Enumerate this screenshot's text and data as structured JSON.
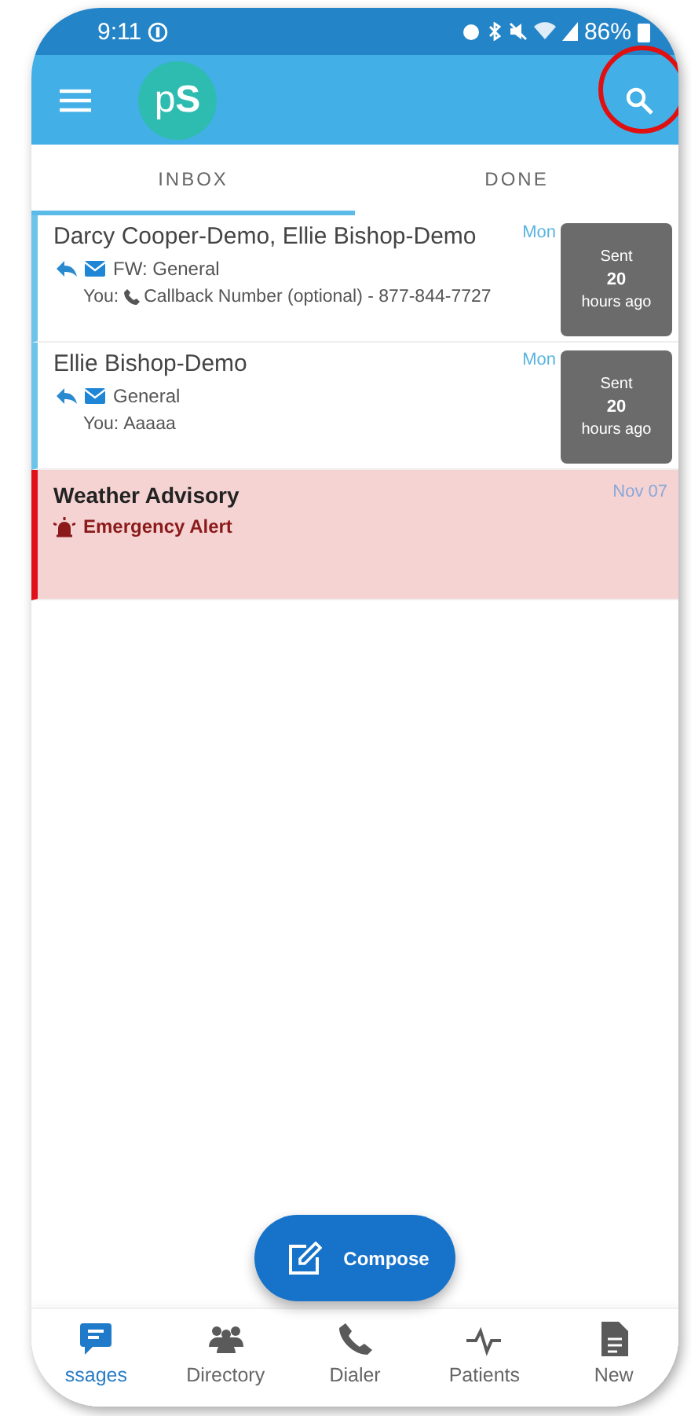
{
  "status_bar": {
    "time": "9:11",
    "battery": "86%"
  },
  "app_bar": {
    "logo": "p**S**"
  },
  "tabs": [
    {
      "label": "INBOX",
      "selected": true
    },
    {
      "label": "DONE",
      "selected": false
    }
  ],
  "messages": [
    {
      "kind": "message",
      "title": "Darcy Cooper-Demo, Ellie Bishop-Demo",
      "date": "Mon",
      "subject": "FW: General",
      "preview_prefix": "You:",
      "has_phone": true,
      "preview": "Callback Number (optional) - 877-844-7727",
      "badge": {
        "top": "Sent",
        "count": "20",
        "bottom": "hours ago"
      }
    },
    {
      "kind": "message",
      "title": "Ellie Bishop-Demo",
      "date": "Mon",
      "subject": "General",
      "preview_prefix": "You:",
      "has_phone": false,
      "preview": "Aaaaa",
      "badge": {
        "top": "Sent",
        "count": "20",
        "bottom": "hours ago"
      }
    },
    {
      "kind": "alert",
      "title": "Weather Advisory",
      "date": "Nov 07",
      "label": "Emergency Alert"
    }
  ],
  "compose": {
    "label": "Compose"
  },
  "nav": [
    {
      "label": "ssages",
      "selected": true
    },
    {
      "label": "Directory",
      "selected": false
    },
    {
      "label": "Dialer",
      "selected": false
    },
    {
      "label": "Patients",
      "selected": false
    },
    {
      "label": "New",
      "selected": false
    }
  ]
}
